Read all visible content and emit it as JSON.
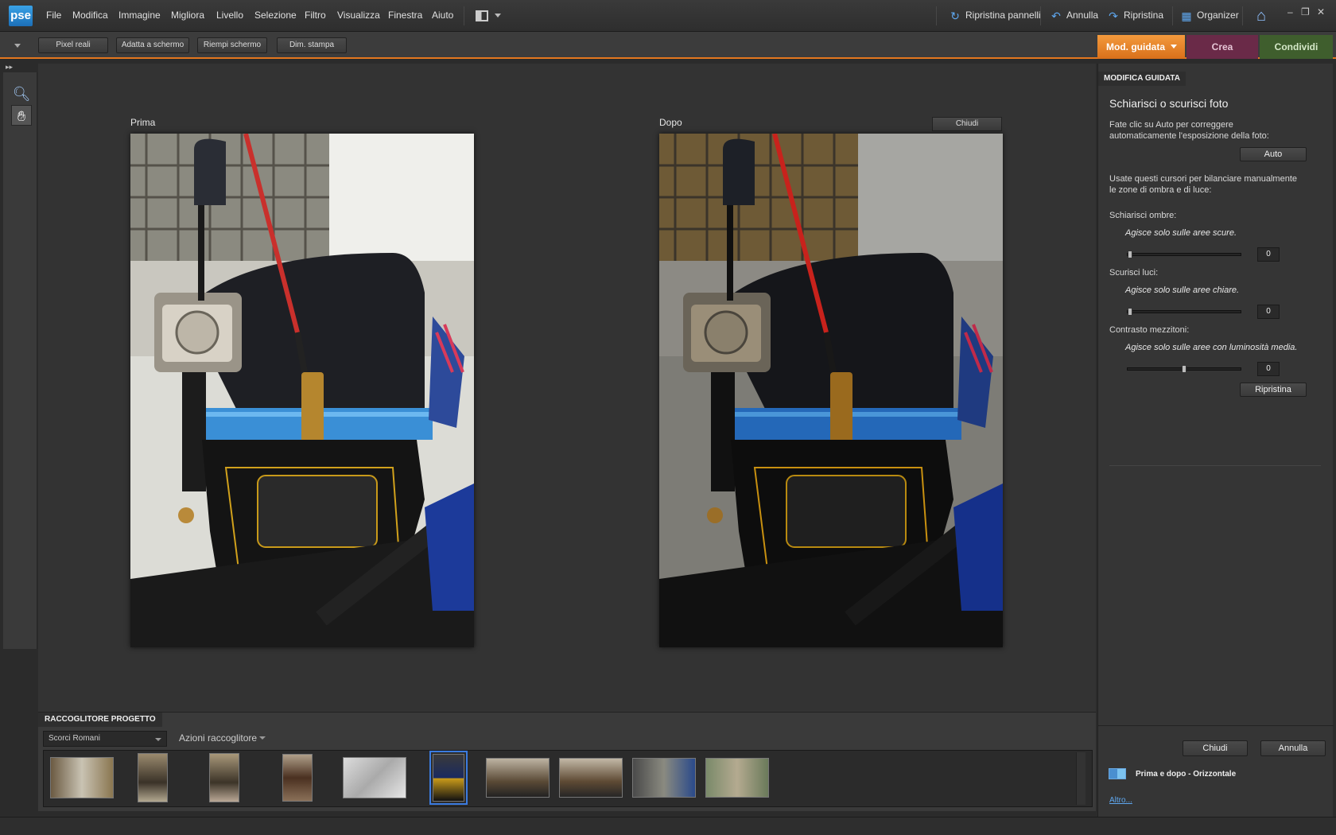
{
  "app": {
    "logo": "pse"
  },
  "menu": [
    "File",
    "Modifica",
    "Immagine",
    "Migliora",
    "Livello",
    "Selezione",
    "Filtro",
    "Visualizza",
    "Finestra",
    "Aiuto"
  ],
  "top_actions": {
    "reset_panels": "Ripristina pannelli",
    "undo": "Annulla",
    "redo": "Ripristina",
    "organizer": "Organizer"
  },
  "options_bar": {
    "buttons": [
      "Pixel reali",
      "Adatta a schermo",
      "Riempi schermo",
      "Dim. stampa"
    ]
  },
  "mode_tabs": {
    "guided": "Mod. guidata",
    "create": "Crea",
    "share": "Condividi"
  },
  "canvas": {
    "before_label": "Prima",
    "after_label": "Dopo",
    "close_button": "Chiudi"
  },
  "project_bin": {
    "title": "RACCOGLITORE PROGETTO",
    "album": "Scorci Romani",
    "actions": "Azioni raccoglitore",
    "thumbnails_count": 10,
    "selected_index": 5
  },
  "guided_panel": {
    "header": "MODIFICA GUIDATA",
    "title": "Schiarisci o scurisci foto",
    "auto_text": "Fate clic su Auto per correggere automaticamente l'esposizione della foto:",
    "auto_button": "Auto",
    "manual_text": "Usate questi cursori per bilanciare manualmente le zone di ombra e di luce:",
    "shadows_label": "Schiarisci ombre:",
    "shadows_hint": "Agisce solo sulle aree scure.",
    "shadows_value": "0",
    "highlights_label": "Scurisci luci:",
    "highlights_hint": "Agisce solo sulle aree chiare.",
    "highlights_value": "0",
    "midtone_label": "Contrasto mezzitoni:",
    "midtone_hint": "Agisce solo sulle aree con luminosità media.",
    "midtone_value": "0",
    "reset_button": "Ripristina",
    "done_button": "Chiudi",
    "cancel_button": "Annulla",
    "view_label": "Prima e dopo - Orizzontale",
    "more_link": "Altro..."
  },
  "colors": {
    "accent": "#e3771e",
    "guided_tab": "#e07f24",
    "create_tab": "#6a2a48",
    "share_tab": "#3f5e2d",
    "link": "#5fa8f0"
  }
}
